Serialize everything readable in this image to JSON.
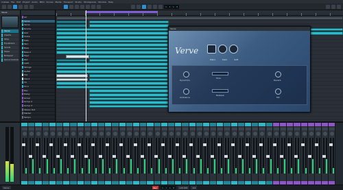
{
  "menu": [
    "Cubase",
    "File",
    "Edit",
    "Project",
    "Audio",
    "MIDI",
    "Scores",
    "Media",
    "Transport",
    "Studio",
    "Workspaces",
    "Window",
    "Help"
  ],
  "colors": {
    "accent": "#2fb9c9",
    "accent_dark": "#1f8797",
    "loop": "#7c5fd6",
    "purple_group": "#8e56c8",
    "meter": "#2ed37a"
  },
  "toolbar": {
    "time_display": "1. 1. 1. 0"
  },
  "inspector": {
    "track_name": "Verve",
    "rows": [
      "Verve",
      "Inserts",
      "Strip",
      "Equalizers",
      "Sends",
      "Fader",
      "Notepad",
      "Quick Controls"
    ]
  },
  "tracks": [
    {
      "name": "Arr",
      "color": "#8e56c8"
    },
    {
      "name": "Verve",
      "color": "#2fb9c9"
    },
    {
      "name": "Verve",
      "color": "#2fb9c9"
    },
    {
      "name": "Drums",
      "color": "#2fb9c9"
    },
    {
      "name": "Kick",
      "color": "#2fb9c9"
    },
    {
      "name": "Snare",
      "color": "#2fb9c9"
    },
    {
      "name": "Hats",
      "color": "#2fb9c9"
    },
    {
      "name": "Perc",
      "color": "#2fb9c9"
    },
    {
      "name": "Bass",
      "color": "#2fb9c9"
    },
    {
      "name": "Bass 2",
      "color": "#2fb9c9"
    },
    {
      "name": "Keys",
      "color": "#2fb9c9"
    },
    {
      "name": "Pad",
      "color": "#2fb9c9"
    },
    {
      "name": "Lead",
      "color": "#2fb9c9"
    },
    {
      "name": "Strings",
      "color": "#2fb9c9"
    },
    {
      "name": "Guitar",
      "color": "#2fb9c9"
    },
    {
      "name": "Vox",
      "color": "#cfe7ec"
    },
    {
      "name": "Vox 2",
      "color": "#cfe7ec"
    },
    {
      "name": "FX",
      "color": "#2fb9c9"
    },
    {
      "name": "FX 2",
      "color": "#2fb9c9"
    },
    {
      "name": "Rev",
      "color": "#8e56c8"
    },
    {
      "name": "Delay",
      "color": "#8e56c8"
    },
    {
      "name": "Group",
      "color": "#8e56c8"
    },
    {
      "name": "Group 2",
      "color": "#8e56c8"
    },
    {
      "name": "Group 3",
      "color": "#8e56c8"
    },
    {
      "name": "Stereo Out",
      "color": "#6b747e"
    },
    {
      "name": "Marker",
      "color": "#6b747e"
    },
    {
      "name": "Tempo",
      "color": "#6b747e"
    }
  ],
  "verve": {
    "window_title": "Verve",
    "logo": "Verve",
    "tabs": [
      "Piano",
      "Dark",
      "Soft"
    ],
    "labels": [
      "Dynamics",
      "Tone",
      "Reverb",
      "Ambience",
      "Release",
      "Mic"
    ]
  },
  "mixer": {
    "strip_count": 45,
    "purple_from": 36
  },
  "status": {
    "left": "Verve",
    "record": "Rec",
    "time": "1. 1. 1. 0",
    "tempo": "120.000",
    "sig": "4/4"
  }
}
